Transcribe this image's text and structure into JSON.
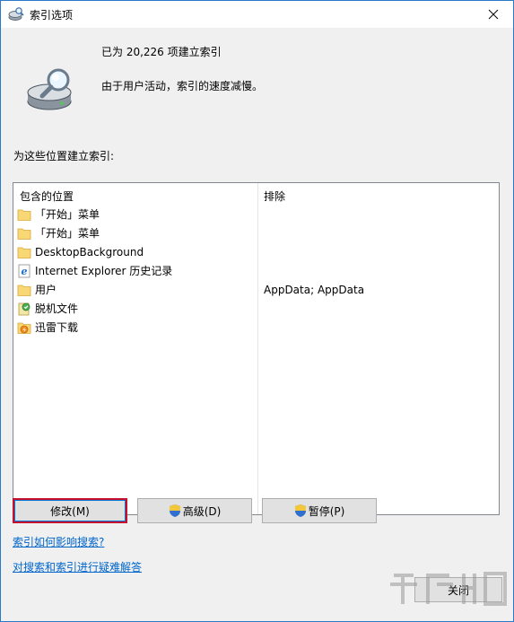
{
  "window": {
    "title": "索引选项",
    "close_symbol": "✕"
  },
  "status": {
    "count_text": "已为 20,226 项建立索引",
    "message": "由于用户活动，索引的速度减慢。"
  },
  "section_label": "为这些位置建立索引:",
  "columns": {
    "location": "包含的位置",
    "exclude": "排除"
  },
  "locations": [
    {
      "icon": "folder-icon",
      "name": "「开始」菜单",
      "exclude": ""
    },
    {
      "icon": "folder-icon",
      "name": "「开始」菜单",
      "exclude": ""
    },
    {
      "icon": "folder-icon",
      "name": "DesktopBackground",
      "exclude": ""
    },
    {
      "icon": "internet-explorer-icon",
      "name": "Internet Explorer 历史记录",
      "exclude": ""
    },
    {
      "icon": "folder-icon",
      "name": "用户",
      "exclude": "AppData; AppData"
    },
    {
      "icon": "offline-files-icon",
      "name": "脱机文件",
      "exclude": ""
    },
    {
      "icon": "xunlei-icon",
      "name": "迅雷下载",
      "exclude": ""
    }
  ],
  "buttons": {
    "modify": "修改(M)",
    "advanced": "高级(D)",
    "pause": "暂停(P)",
    "close": "关闭"
  },
  "links": {
    "how_index_affects": "索引如何影响搜索?",
    "troubleshoot": "对搜索和索引进行疑难解答"
  },
  "colors": {
    "title_border": "#2b79c9",
    "focus_red": "#c8102e",
    "link": "#0066cc",
    "folder": "#f8d775"
  }
}
